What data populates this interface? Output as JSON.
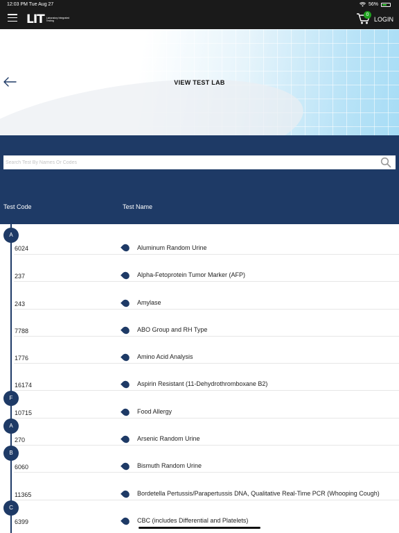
{
  "status_bar": {
    "time": "12:03 PM  Tue Aug 27",
    "battery": "56%"
  },
  "header": {
    "logo_mark": "LIT",
    "logo_text": "Laboratory Integrated Testing",
    "cart_count": "0",
    "login_label": "LOGIN"
  },
  "hero": {
    "title": "VIEW TEST LAB"
  },
  "search": {
    "placeholder": "Search Test By Names Or Codes"
  },
  "columns": {
    "code": "Test Code",
    "name": "Test Name"
  },
  "letters": [
    "A",
    "F",
    "A",
    "B",
    "C"
  ],
  "tests": [
    {
      "code": "6024",
      "name": "Aluminum  Random Urine"
    },
    {
      "code": "237",
      "name": "Alpha-Fetoprotein Tumor Marker (AFP)"
    },
    {
      "code": "243",
      "name": "Amylase"
    },
    {
      "code": "7788",
      "name": "ABO Group and RH Type"
    },
    {
      "code": "1776",
      "name": "Amino Acid Analysis"
    },
    {
      "code": "16174",
      "name": "Aspirin Resistant (11-Dehydrothromboxane B2)"
    },
    {
      "code": "10715",
      "name": "Food Allergy"
    },
    {
      "code": "270",
      "name": "Arsenic Random Urine"
    },
    {
      "code": "6060",
      "name": "Bismuth Random Urine"
    },
    {
      "code": "11365",
      "name": "Bordetella Pertussis/Parapertussis DNA, Qualitative Real-Time PCR (Whooping Cough)"
    },
    {
      "code": "6399",
      "name": "CBC (includes Differential and Platelets)"
    }
  ],
  "colors": {
    "navy": "#1e3a66",
    "topbar": "#1a1a1a",
    "badge": "#1fa11f"
  }
}
